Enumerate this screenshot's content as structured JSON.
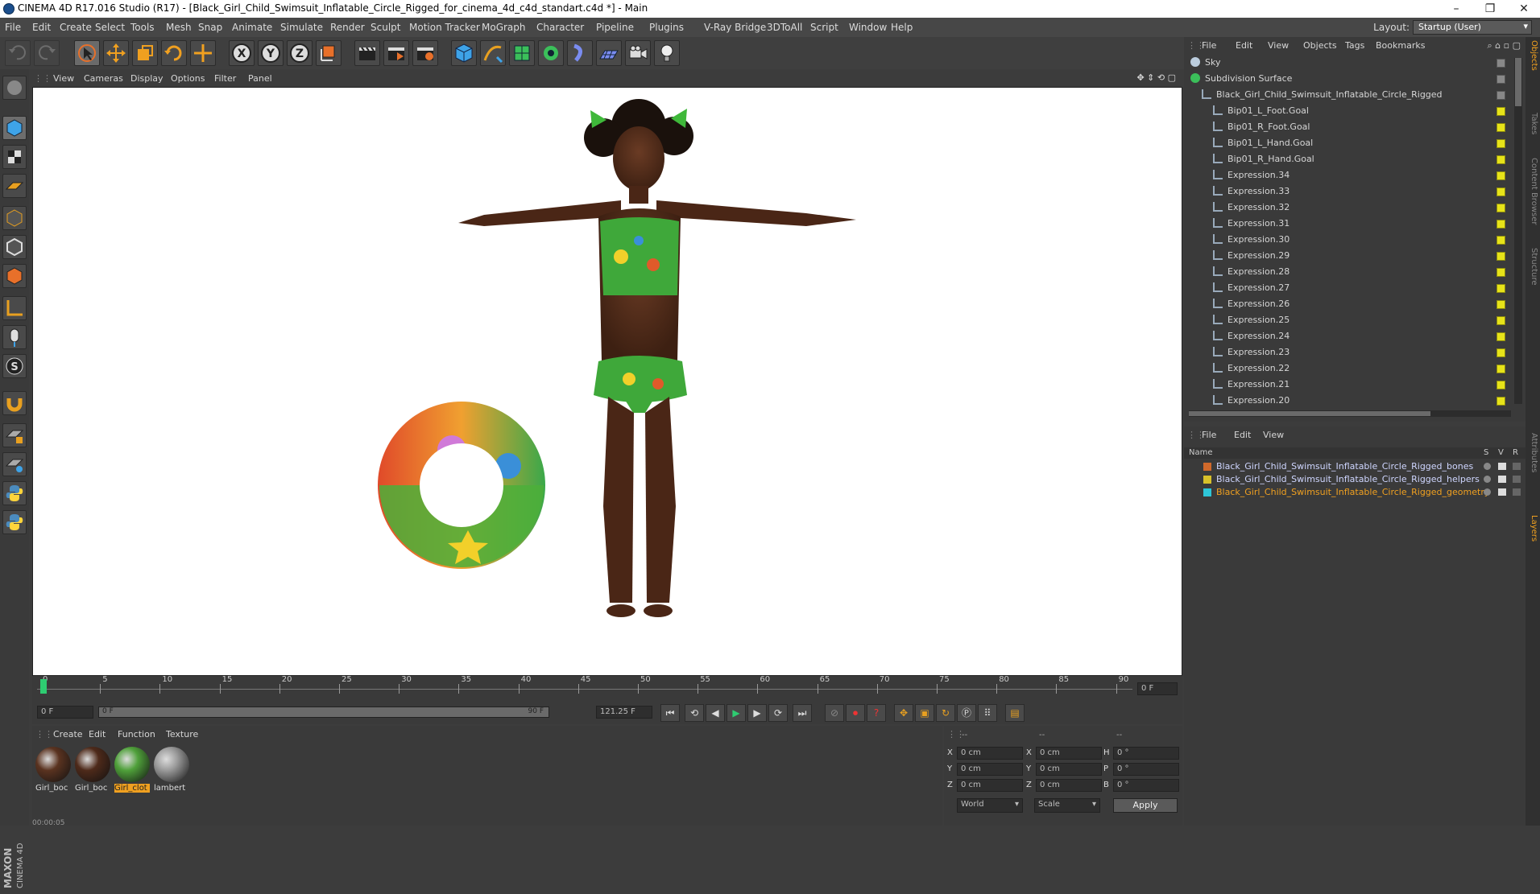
{
  "window": {
    "title": "CINEMA 4D R17.016 Studio (R17) - [Black_Girl_Child_Swimsuit_Inflatable_Circle_Rigged_for_cinema_4d_c4d_standart.c4d *] - Main"
  },
  "menubar": {
    "items": [
      "File",
      "Edit",
      "Create",
      "Select",
      "Tools",
      "Mesh",
      "Snap",
      "Animate",
      "Simulate",
      "Render",
      "Sculpt",
      "Motion Tracker",
      "MoGraph",
      "Character",
      "Pipeline",
      "Plugins",
      "V-Ray Bridge",
      "3DToAll",
      "Script",
      "Window",
      "Help"
    ],
    "layout_label": "Layout:",
    "layout_value": "Startup (User)"
  },
  "viewport": {
    "menu": [
      "View",
      "Cameras",
      "Display",
      "Options",
      "Filter",
      "Panel"
    ]
  },
  "timeline": {
    "ticks": [
      "0",
      "5",
      "10",
      "15",
      "20",
      "25",
      "30",
      "35",
      "40",
      "45",
      "50",
      "55",
      "60",
      "65",
      "70",
      "75",
      "80",
      "85",
      "90"
    ],
    "frame_field": "0 F",
    "start_field": "0 F",
    "range_start": "0 F",
    "range_end": "90 F",
    "end_field": "121.25 F"
  },
  "materials": {
    "menu": [
      "Create",
      "Edit",
      "Function",
      "Texture"
    ],
    "items": [
      {
        "label": "Girl_boc",
        "color": "#5a3320",
        "selected": false
      },
      {
        "label": "Girl_boc",
        "color": "#4e2a1a",
        "selected": false
      },
      {
        "label": "Girl_clot",
        "color": "#4fa03a",
        "selected": true
      },
      {
        "label": "lambert",
        "color": "#9a9a9a",
        "selected": false
      }
    ]
  },
  "coords": {
    "header": [
      "--",
      "--",
      "--"
    ],
    "rows": [
      {
        "a": "X",
        "av": "0 cm",
        "b": "X",
        "bv": "0 cm",
        "c": "H",
        "cv": "0 °"
      },
      {
        "a": "Y",
        "av": "0 cm",
        "b": "Y",
        "bv": "0 cm",
        "c": "P",
        "cv": "0 °"
      },
      {
        "a": "Z",
        "av": "0 cm",
        "b": "Z",
        "bv": "0 cm",
        "c": "B",
        "cv": "0 °"
      }
    ],
    "world": "World",
    "scale": "Scale",
    "apply": "Apply"
  },
  "objects_panel": {
    "menu": [
      "File",
      "Edit",
      "View",
      "Objects",
      "Tags",
      "Bookmarks"
    ],
    "rows": [
      {
        "label": "Sky",
        "indent": 0
      },
      {
        "label": "Subdivision Surface",
        "indent": 0
      },
      {
        "label": "Black_Girl_Child_Swimsuit_Inflatable_Circle_Rigged",
        "indent": 1
      },
      {
        "label": "Bip01_L_Foot.Goal",
        "indent": 2
      },
      {
        "label": "Bip01_R_Foot.Goal",
        "indent": 2
      },
      {
        "label": "Bip01_L_Hand.Goal",
        "indent": 2
      },
      {
        "label": "Bip01_R_Hand.Goal",
        "indent": 2
      },
      {
        "label": "Expression.34",
        "indent": 2
      },
      {
        "label": "Expression.33",
        "indent": 2
      },
      {
        "label": "Expression.32",
        "indent": 2
      },
      {
        "label": "Expression.31",
        "indent": 2
      },
      {
        "label": "Expression.30",
        "indent": 2
      },
      {
        "label": "Expression.29",
        "indent": 2
      },
      {
        "label": "Expression.28",
        "indent": 2
      },
      {
        "label": "Expression.27",
        "indent": 2
      },
      {
        "label": "Expression.26",
        "indent": 2
      },
      {
        "label": "Expression.25",
        "indent": 2
      },
      {
        "label": "Expression.24",
        "indent": 2
      },
      {
        "label": "Expression.23",
        "indent": 2
      },
      {
        "label": "Expression.22",
        "indent": 2
      },
      {
        "label": "Expression.21",
        "indent": 2
      },
      {
        "label": "Expression.20",
        "indent": 2
      }
    ]
  },
  "layers_panel": {
    "menu": [
      "File",
      "Edit",
      "View"
    ],
    "header": {
      "name": "Name",
      "s": "S",
      "v": "V",
      "r": "R"
    },
    "rows": [
      {
        "label": "Black_Girl_Child_Swimsuit_Inflatable_Circle_Rigged_bones",
        "color": "#d0692b",
        "highlight": false
      },
      {
        "label": "Black_Girl_Child_Swimsuit_Inflatable_Circle_Rigged_helpers",
        "color": "#d8c12a",
        "highlight": false
      },
      {
        "label": "Black_Girl_Child_Swimsuit_Inflatable_Circle_Rigged_geometry",
        "color": "#2ec6d8",
        "highlight": true
      }
    ]
  },
  "right_strip_tabs": [
    "Objects",
    "Takes",
    "Content Browser",
    "Structure",
    "Attributes",
    "Layers"
  ],
  "status": {
    "time": "00:00:05"
  },
  "brand": {
    "top": "MAXON",
    "bottom": "CINEMA 4D"
  }
}
